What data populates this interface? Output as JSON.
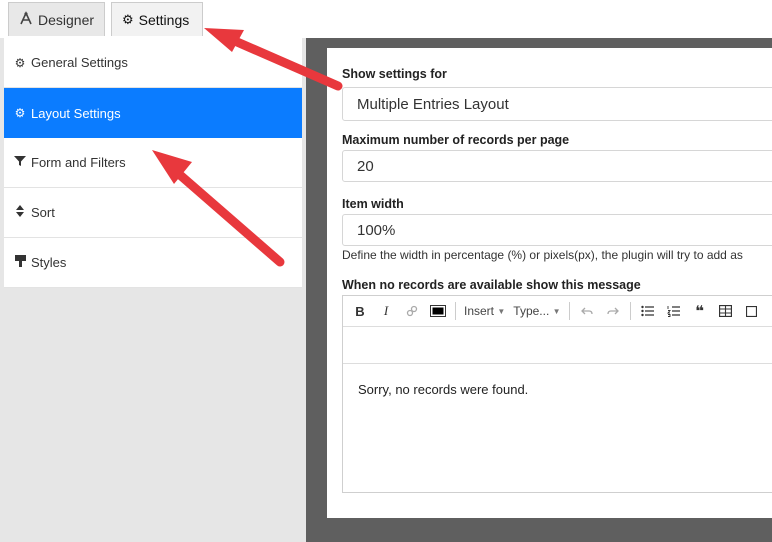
{
  "tabs": [
    {
      "label": "Designer",
      "icon": "designer-icon",
      "active": false
    },
    {
      "label": "Settings",
      "icon": "gear-icon",
      "active": true
    }
  ],
  "sidebar": {
    "items": [
      {
        "label": "General Settings",
        "icon": "gear-icon",
        "active": false
      },
      {
        "label": "Layout Settings",
        "icon": "gear-icon",
        "active": true
      },
      {
        "label": "Form and Filters",
        "icon": "filter-icon",
        "active": false
      },
      {
        "label": "Sort",
        "icon": "sort-icon",
        "active": false
      },
      {
        "label": "Styles",
        "icon": "paint-icon",
        "active": false
      }
    ]
  },
  "form": {
    "show_settings_label": "Show settings for",
    "show_settings_value": "Multiple Entries Layout",
    "max_records_label": "Maximum number of records per page",
    "max_records_value": "20",
    "item_width_label": "Item width",
    "item_width_value": "100%",
    "item_width_help": "Define the width in percentage (%) or pixels(px), the plugin will try to add as",
    "no_records_label": "When no records are available show this message"
  },
  "editor": {
    "toolbar": {
      "bold": "B",
      "italic": "I",
      "insert_label": "Insert",
      "type_label": "Type...",
      "quote": "❝"
    },
    "content": "Sorry, no records were found."
  },
  "colors": {
    "active": "#0b7cff",
    "arrow": "#e8383d",
    "backdrop": "#5f5f5f"
  }
}
